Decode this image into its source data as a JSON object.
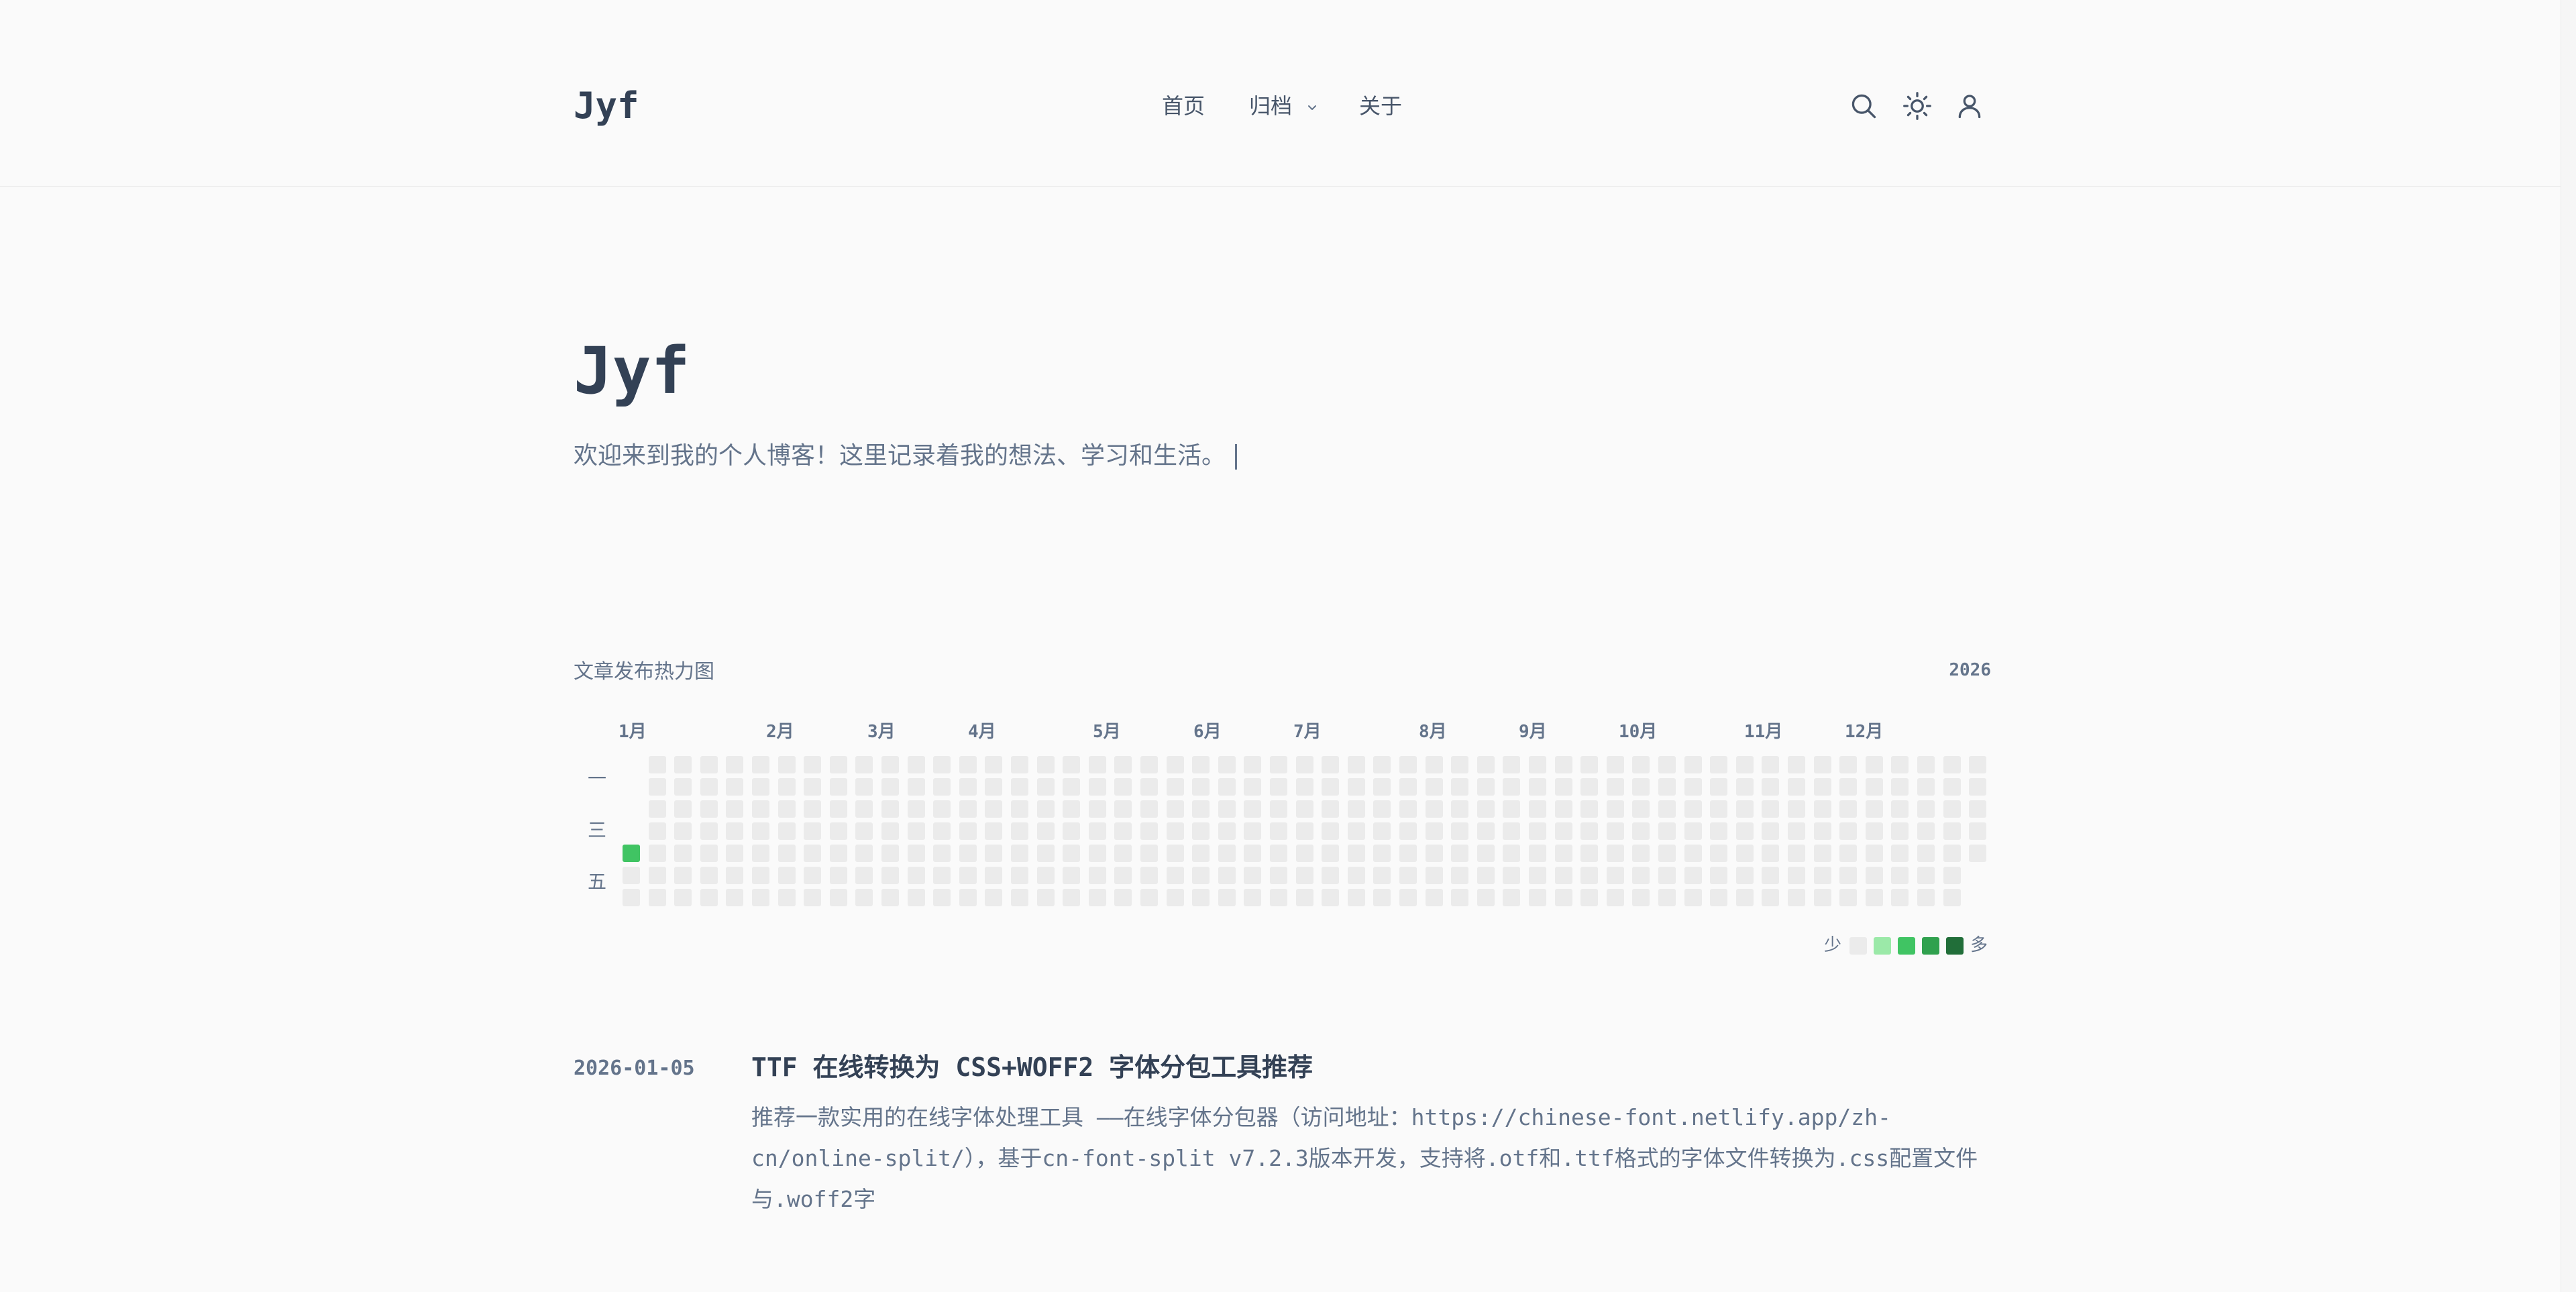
{
  "header": {
    "logo": "Jyf",
    "nav": [
      {
        "label": "首页"
      },
      {
        "label": "归档"
      },
      {
        "label": "关于"
      }
    ],
    "icons": [
      "search-icon",
      "sun-icon",
      "user-icon"
    ]
  },
  "hero": {
    "title": "Jyf",
    "subtitle": "欢迎来到我的个人博客！这里记录着我的想法、学习和生活。"
  },
  "heatmap": {
    "title": "文章发布热力图",
    "year": "2026",
    "months": [
      "1月",
      "2月",
      "3月",
      "4月",
      "5月",
      "6月",
      "7月",
      "8月",
      "9月",
      "10月",
      "11月",
      "12月"
    ],
    "day_labels": [
      "一",
      "三",
      "五"
    ],
    "weeks": 53,
    "posts": [
      {
        "date": "2026-01-01",
        "count": 1
      }
    ],
    "legend": {
      "less": "少",
      "more": "多"
    },
    "colors": {
      "empty": "#ebebeb",
      "levels": [
        "#ebebeb",
        "#9be9a8",
        "#40c463",
        "#30a14e",
        "#216e39"
      ]
    }
  },
  "posts": [
    {
      "date": "2026-01-05",
      "title": "TTF 在线转换为 CSS+WOFF2 字体分包工具推荐",
      "excerpt": "推荐一款实用的在线字体处理工具 ——在线字体分包器（访问地址：https://chinese-font.netlify.app/zh-cn/online-split/），基于cn-font-split v7.2.3版本开发，支持将.otf和.ttf格式的字体文件转换为.css配置文件与.woff2字"
    }
  ]
}
